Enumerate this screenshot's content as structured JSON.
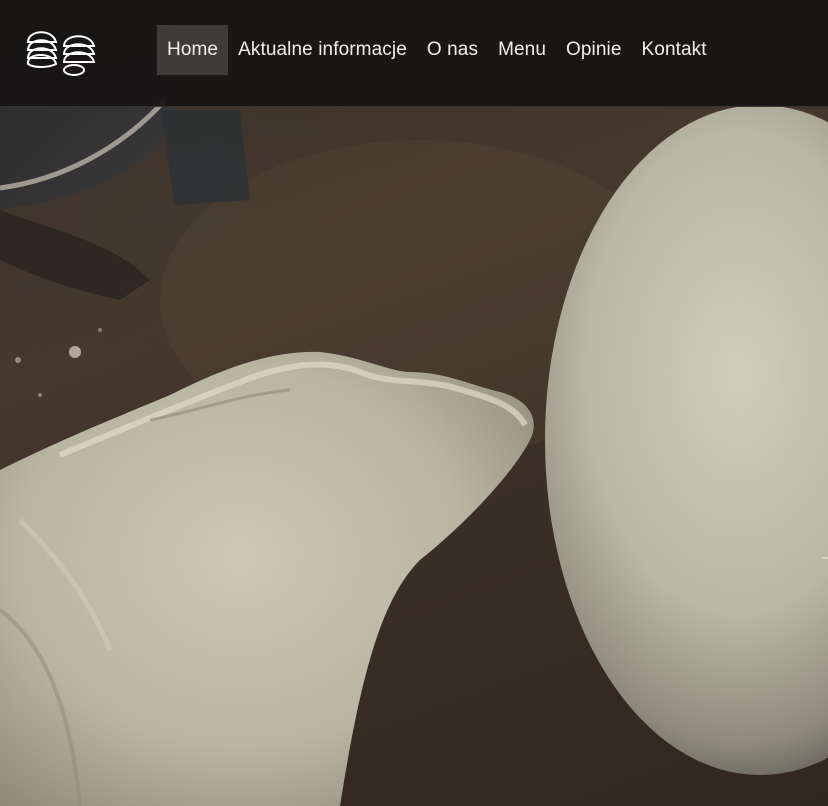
{
  "site": {
    "logo_name": "pierogi-logo"
  },
  "nav": {
    "items": [
      {
        "label": "Home",
        "active": true
      },
      {
        "label": "Aktualne informacje",
        "active": false
      },
      {
        "label": "O nas",
        "active": false
      },
      {
        "label": "Menu",
        "active": false
      },
      {
        "label": "Opinie",
        "active": false
      },
      {
        "label": "Kontakt",
        "active": false
      }
    ]
  },
  "hero": {
    "image": "dumplings-dough-on-table"
  },
  "colors": {
    "navbar_bg": "#161414",
    "nav_text": "#f2efea",
    "active_bg": "#5f5c56",
    "dough": "#c9c6b3"
  }
}
